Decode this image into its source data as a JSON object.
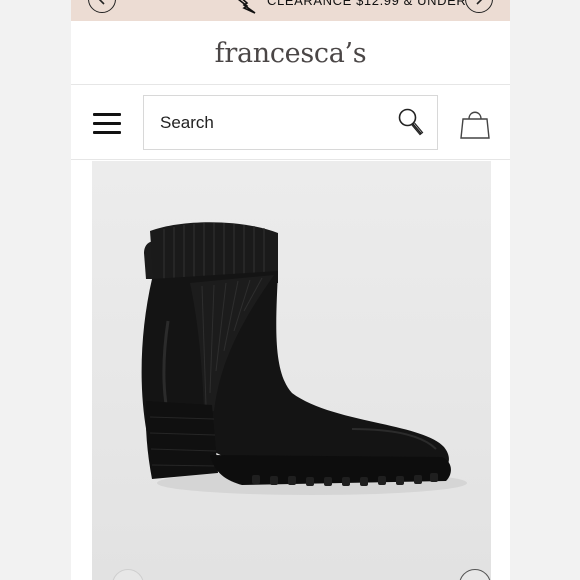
{
  "promo": {
    "text": "CLEARANCE $12.99 & UNDER",
    "prev_icon": "chevron-left-icon",
    "next_icon": "chevron-right-icon"
  },
  "brand": {
    "logo_text": "francesca’s"
  },
  "header": {
    "menu_icon": "hamburger-menu-icon",
    "search": {
      "placeholder": "Search"
    },
    "search_icon": "magnifier-icon",
    "bag_icon": "shopping-bag-icon"
  },
  "product": {
    "image_subject": "black-chelsea-ankle-boot",
    "gallery_prev_icon": "chevron-left-icon",
    "gallery_next_icon": "chevron-right-icon"
  },
  "colors": {
    "promo_bg": "#ecdcd3",
    "logo": "#4a4646",
    "image_bg": "#e8e8e8",
    "boot": "#141414"
  }
}
